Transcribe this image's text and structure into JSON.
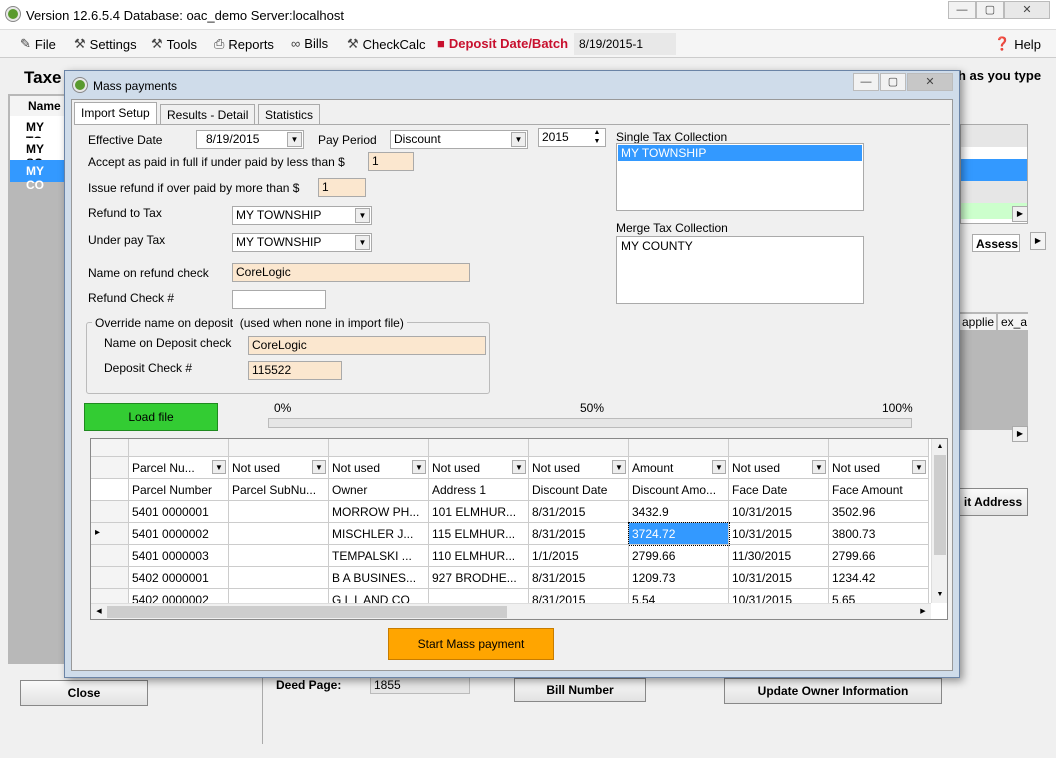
{
  "window": {
    "title": "Version 12.6.5.4 Database: oac_demo Server:localhost",
    "min": "—",
    "max": "▢",
    "close": "✕"
  },
  "menu": {
    "file": "File",
    "settings": "Settings",
    "tools": "Tools",
    "reports": "Reports",
    "bills": "Bills",
    "checkcalc": "CheckCalc",
    "deposit": "Deposit Date/Batch",
    "batch_value": "8/19/2015-1",
    "help": "Help"
  },
  "background": {
    "taxes_label": "Taxe",
    "type_hint": "h as you type",
    "name_header": "Name",
    "rows": [
      "MY TO",
      "MY SC",
      "MY CO"
    ],
    "assess_tab": "Assess",
    "right_cols": [
      "applie",
      "ex_a"
    ],
    "edit_address": "it Address",
    "close_btn": "Close",
    "deed_page_label": "Deed Page:",
    "deed_page_value": "1855",
    "bill_number_btn": "Bill Number",
    "update_owner_btn": "Update Owner Information"
  },
  "dialog": {
    "title": "Mass payments",
    "tabs": [
      "Import Setup",
      "Results - Detail",
      "Statistics"
    ],
    "effective_date_label": "Effective Date",
    "effective_date": "8/19/2015",
    "pay_period_label": "Pay Period",
    "pay_period": "Discount",
    "year": "2015",
    "accept_label": "Accept as paid in full if under paid by less than $",
    "accept_value": "1",
    "refund_label": "Issue refund if over paid by more than $",
    "refund_value": "1",
    "refund_to_tax_label": "Refund to Tax",
    "refund_to_tax": "MY TOWNSHIP",
    "under_pay_tax_label": "Under pay Tax",
    "under_pay_tax": "MY TOWNSHIP",
    "name_on_refund_label": "Name on refund check",
    "name_on_refund": "CoreLogic",
    "refund_check_label": "Refund Check #",
    "refund_check": "",
    "override_group": "Override name on deposit",
    "override_note": "(used when none in import file)",
    "name_on_deposit_label": "Name on Deposit check",
    "name_on_deposit": "CoreLogic",
    "deposit_check_label": "Deposit Check #",
    "deposit_check": "115522",
    "single_tax_label": "Single Tax Collection",
    "single_tax_items": [
      "MY TOWNSHIP"
    ],
    "merge_tax_label": "Merge Tax Collection",
    "merge_tax_items": [
      "MY COUNTY"
    ],
    "load_file_btn": "Load file",
    "progress": {
      "p0": "0%",
      "p50": "50%",
      "p100": "100%",
      "value": 0
    },
    "start_btn": "Start Mass payment",
    "grid": {
      "mappings": [
        "Parcel Nu...",
        "Not used",
        "Not used",
        "Not used",
        "Not used",
        "Amount",
        "Not used",
        "Not used"
      ],
      "headers": [
        "Parcel Number",
        "Parcel SubNu...",
        "Owner",
        "Address 1",
        "Discount Date",
        "Discount Amo...",
        "Face Date",
        "Face Amount"
      ],
      "rows": [
        [
          "5401 0000001",
          "",
          "MORROW PH...",
          "101 ELMHUR...",
          "8/31/2015",
          "3432.9",
          "10/31/2015",
          "3502.96"
        ],
        [
          "5401 0000002",
          "",
          "MISCHLER J...",
          "115 ELMHUR...",
          "8/31/2015",
          "3724.72",
          "10/31/2015",
          "3800.73"
        ],
        [
          "5401 0000003",
          "",
          "TEMPALSKI ...",
          "110 ELMHUR...",
          "1/1/2015",
          "2799.66",
          "11/30/2015",
          "2799.66"
        ],
        [
          "5402 0000001",
          "",
          "B A BUSINES...",
          "927 BRODHE...",
          "8/31/2015",
          "1209.73",
          "10/31/2015",
          "1234.42"
        ],
        [
          "5402 0000002",
          "",
          "G L L AND CO",
          "",
          "8/31/2015",
          "5.54",
          "10/31/2015",
          "5.65"
        ]
      ],
      "current_row_marker": "▸"
    }
  }
}
